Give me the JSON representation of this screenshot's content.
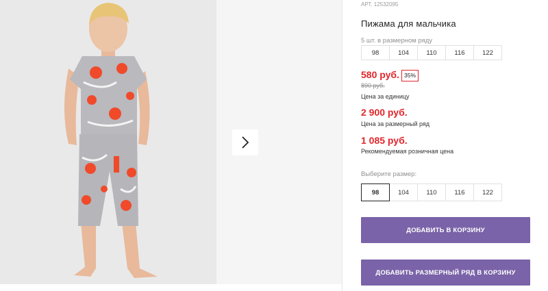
{
  "product": {
    "sku": "АРТ. 12532095",
    "title": "Пижама для мальчика",
    "row_note": "5 шт. в размерном ряду",
    "row_sizes": [
      "98",
      "104",
      "110",
      "116",
      "122"
    ],
    "price": "580 руб.",
    "discount": "35%",
    "old_price": "890 руб.",
    "unit_caption": "Цена за единицу",
    "row_price": "2 900 руб.",
    "row_caption": "Цена за размерный ряд",
    "retail_price": "1 085 руб.",
    "retail_caption": "Рекомендуемая розничная цена",
    "choose_label": "Выберите размер:",
    "sizes": [
      "98",
      "104",
      "110",
      "116",
      "122"
    ],
    "selected_size": "98",
    "add_to_cart": "ДОБАВИТЬ В КОРЗИНУ",
    "add_row_to_cart": "ДОБАВИТЬ РАЗМЕРНЫЙ РЯД В КОРЗИНУ"
  },
  "gallery": {
    "next_icon": "chevron-right-icon"
  },
  "colors": {
    "accent": "#7a63a8",
    "price_red": "#e0262b",
    "photo_bg": "#e9e9ea"
  }
}
